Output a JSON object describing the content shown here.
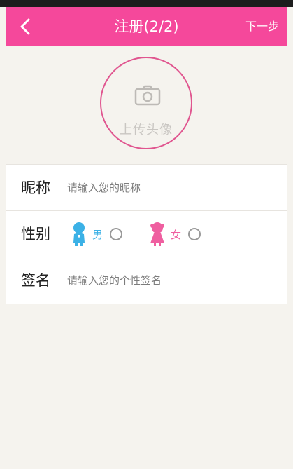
{
  "header": {
    "title": "注册(2/2)",
    "next_label": "下一步",
    "color": "#f5489b"
  },
  "avatar": {
    "label": "上传头像",
    "icon": "camera-icon",
    "border_color": "#e0558f"
  },
  "form": {
    "nickname": {
      "label": "昵称",
      "placeholder": "请输入您的昵称",
      "value": ""
    },
    "gender": {
      "label": "性别",
      "options": [
        {
          "label": "男",
          "icon": "boy-icon",
          "color": "#3bb1e6",
          "selected": false
        },
        {
          "label": "女",
          "icon": "girl-icon",
          "color": "#ef5fa0",
          "selected": false
        }
      ]
    },
    "signature": {
      "label": "签名",
      "placeholder": "请输入您的个性签名",
      "value": ""
    }
  }
}
